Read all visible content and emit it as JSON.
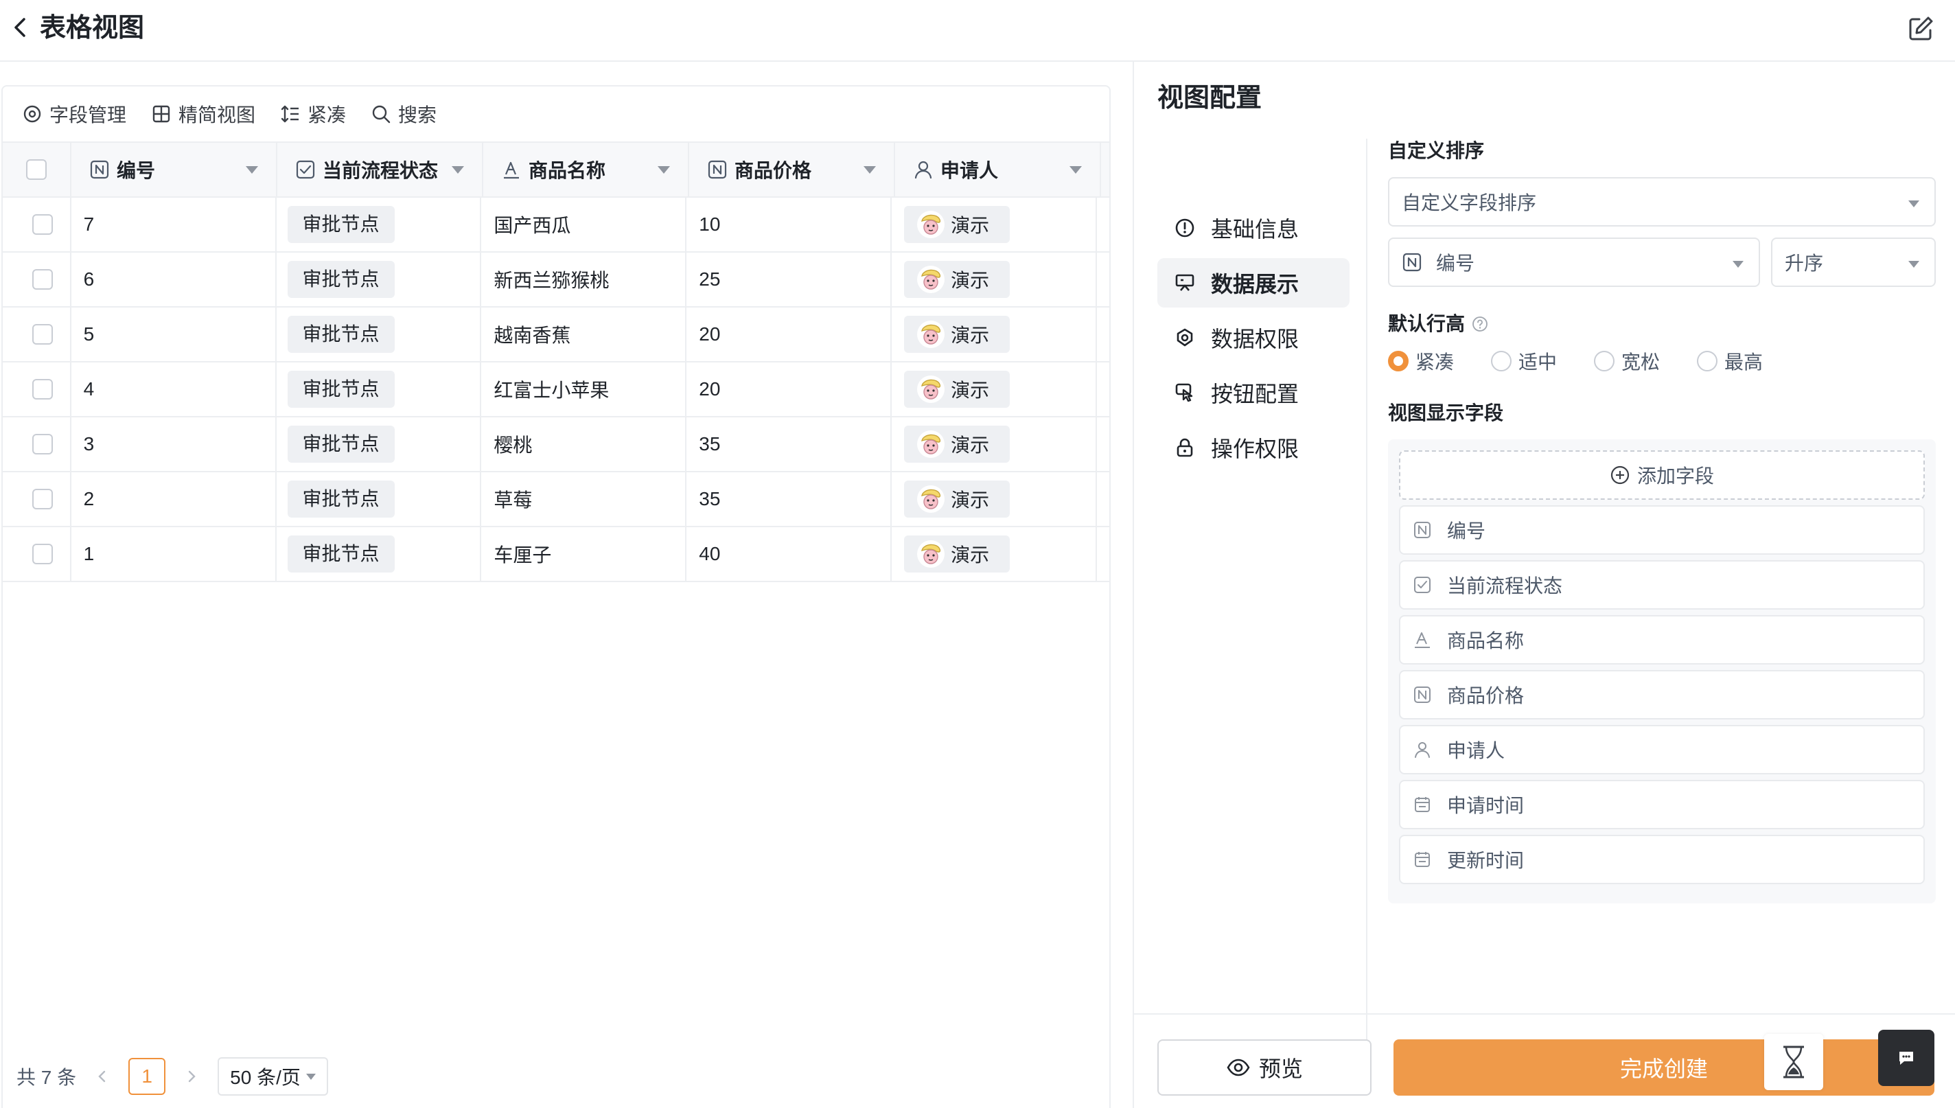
{
  "header": {
    "title": "表格视图"
  },
  "toolbar": {
    "field_manage": "字段管理",
    "simple_view": "精简视图",
    "compact": "紧凑",
    "search": "搜索"
  },
  "table": {
    "columns": [
      {
        "label": "编号",
        "icon": "number-field-icon"
      },
      {
        "label": "当前流程状态",
        "icon": "checkbox-field-icon"
      },
      {
        "label": "商品名称",
        "icon": "text-field-icon"
      },
      {
        "label": "商品价格",
        "icon": "number-field-icon"
      },
      {
        "label": "申请人",
        "icon": "person-field-icon"
      }
    ],
    "rows": [
      {
        "id": "7",
        "status": "审批节点",
        "name": "国产西瓜",
        "price": "10",
        "applicant": "演示"
      },
      {
        "id": "6",
        "status": "审批节点",
        "name": "新西兰猕猴桃",
        "price": "25",
        "applicant": "演示"
      },
      {
        "id": "5",
        "status": "审批节点",
        "name": "越南香蕉",
        "price": "20",
        "applicant": "演示"
      },
      {
        "id": "4",
        "status": "审批节点",
        "name": "红富士小苹果",
        "price": "20",
        "applicant": "演示"
      },
      {
        "id": "3",
        "status": "审批节点",
        "name": "樱桃",
        "price": "35",
        "applicant": "演示"
      },
      {
        "id": "2",
        "status": "审批节点",
        "name": "草莓",
        "price": "35",
        "applicant": "演示"
      },
      {
        "id": "1",
        "status": "审批节点",
        "name": "车厘子",
        "price": "40",
        "applicant": "演示"
      }
    ]
  },
  "pagination": {
    "total": "共 7 条",
    "current": "1",
    "page_size": "50 条/页"
  },
  "config": {
    "title": "视图配置",
    "nav": [
      {
        "label": "基础信息",
        "icon": "info-icon"
      },
      {
        "label": "数据展示",
        "icon": "display-icon"
      },
      {
        "label": "数据权限",
        "icon": "data-permission-icon"
      },
      {
        "label": "按钮配置",
        "icon": "button-config-icon"
      },
      {
        "label": "操作权限",
        "icon": "lock-icon"
      }
    ],
    "active_nav": "数据展示",
    "sort": {
      "label": "自定义排序",
      "sort_type": "自定义字段排序",
      "sort_field": "编号",
      "sort_order": "升序"
    },
    "row_height": {
      "label": "默认行高",
      "options": [
        "紧凑",
        "适中",
        "宽松",
        "最高"
      ],
      "selected": "紧凑"
    },
    "display_fields": {
      "label": "视图显示字段",
      "add_label": "添加字段",
      "fields": [
        {
          "label": "编号",
          "icon": "number-field-icon"
        },
        {
          "label": "当前流程状态",
          "icon": "checkbox-field-icon"
        },
        {
          "label": "商品名称",
          "icon": "text-field-icon"
        },
        {
          "label": "商品价格",
          "icon": "number-field-icon"
        },
        {
          "label": "申请人",
          "icon": "person-field-icon"
        },
        {
          "label": "申请时间",
          "icon": "calendar-icon"
        },
        {
          "label": "更新时间",
          "icon": "calendar-icon"
        }
      ]
    }
  },
  "footer": {
    "preview_label": "预览",
    "create_label": "完成创建"
  },
  "colors": {
    "accent": "#f0913b",
    "create_button": "#ef9a4a"
  }
}
